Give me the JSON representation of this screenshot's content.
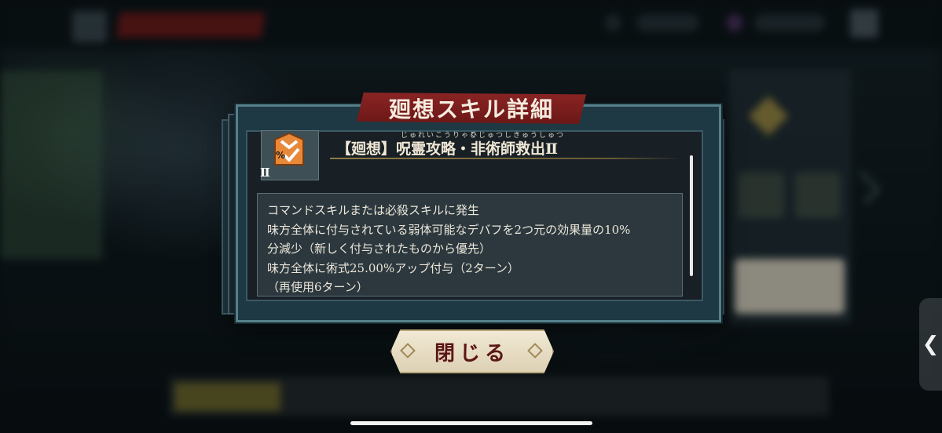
{
  "dialog": {
    "title": "廻想スキル詳細",
    "skill": {
      "rank": "Ⅱ",
      "icon_symbol": "%",
      "icon": "debuff-reduction-icon",
      "name": "【廻想】呪霊攻略・非術師救出Ⅱ",
      "ruby_1": "じゅれいこうりゃく",
      "ruby_2": "ひじゅつしきゅうしゅつ"
    },
    "description": [
      "コマンドスキルまたは必殺スキルに発生",
      "味方全体に付与されている弱体可能なデバフを2つ元の効果量の10%",
      "分減少（新しく付与されたものから優先）",
      "味方全体に術式25.00%アップ付与（2ターン）",
      "（再使用6ターン）"
    ],
    "close_label": "閉じる"
  },
  "side_handle": {
    "label": "❮"
  },
  "colors": {
    "banner": "#8a2424",
    "icon_orange": "#e8893a",
    "panel": "#1e3943",
    "close_text": "#5b1616"
  }
}
